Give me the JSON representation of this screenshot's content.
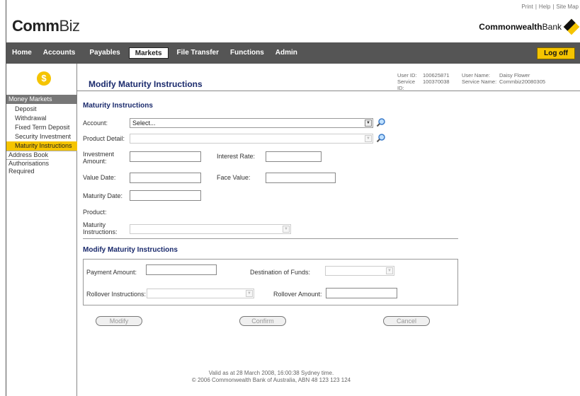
{
  "brand": {
    "bold": "Comm",
    "light": "Biz"
  },
  "top_links": [
    "Print",
    "Help",
    "Site Map"
  ],
  "bank": {
    "bold": "Commonwealth",
    "light": "Bank"
  },
  "nav": {
    "items": [
      "Home",
      "Accounts",
      "Payables",
      "Markets",
      "File Transfer",
      "Functions",
      "Admin"
    ],
    "active": "Markets",
    "logoff": "Log off"
  },
  "sidebar": {
    "icon": "$",
    "header": "Money Markets",
    "items": [
      "Deposit",
      "Withdrawal",
      "Fixed Term Deposit",
      "Security Investment",
      "Maturity Instructions"
    ],
    "active": "Maturity Instructions",
    "extra": [
      "Address Book",
      "Authorisations Required"
    ]
  },
  "page": {
    "title": "Modify Maturity Instructions",
    "user_id_label": "User ID:",
    "user_id": "100625871",
    "user_name_label": "User Name:",
    "user_name": "Daisy Flower",
    "service_id_label": "Service ID:",
    "service_id": "100370038",
    "service_name_label": "Service Name:",
    "service_name": "Commbiz20080305"
  },
  "maturity": {
    "title": "Maturity Instructions",
    "account_label": "Account:",
    "account_value": "Select...",
    "product_detail_label": "Product Detail:",
    "investment_amount_label": "Investment Amount:",
    "interest_rate_label": "Interest Rate:",
    "value_date_label": "Value Date:",
    "face_value_label": "Face Value:",
    "maturity_date_label": "Maturity Date:",
    "product_label": "Product:",
    "maturity_instructions_label": "Maturity Instructions:"
  },
  "modify": {
    "title": "Modify Maturity Instructions",
    "payment_amount_label": "Payment Amount:",
    "destination_label": "Destination of Funds:",
    "rollover_instructions_label": "Rollover Instructions:",
    "rollover_amount_label": "Rollover Amount:"
  },
  "buttons": {
    "modify": "Modify",
    "confirm": "Confirm",
    "cancel": "Cancel"
  },
  "footer": {
    "line1": "Valid as at 28 March 2008, 16:00:38 Sydney time.",
    "line2": "© 2006 Commonwealth Bank of Australia, ABN 48 123 123 124"
  },
  "colors": {
    "accent": "#f5c400",
    "nav_bg": "#555555",
    "title": "#1a2a6c"
  },
  "icons": [
    "search-icon",
    "dropdown-arrow-icon",
    "dollar-icon",
    "cba-diamond-icon"
  ]
}
